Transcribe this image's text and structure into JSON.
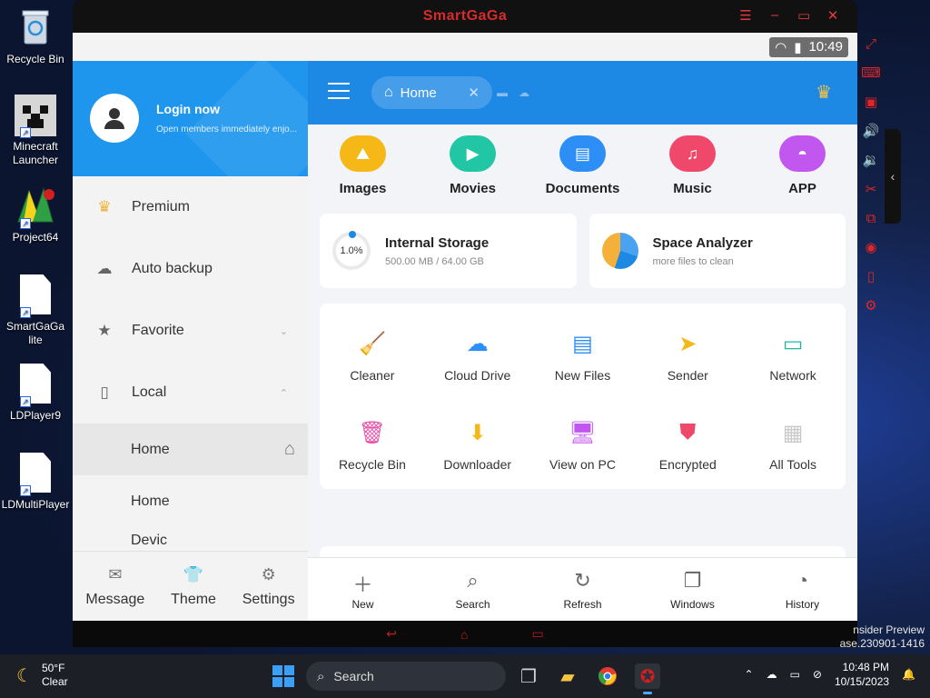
{
  "desktop": {
    "icons": [
      {
        "label": "Recycle Bin"
      },
      {
        "label": "Minecraft Launcher"
      },
      {
        "label": "Project64"
      },
      {
        "label": "SmartGaGa lite"
      },
      {
        "label": "LDPlayer9"
      },
      {
        "label": "LDMultiPlayer"
      }
    ]
  },
  "emulator": {
    "title": "SmartGaGa",
    "time": "10:49"
  },
  "drawer": {
    "login": "Login now",
    "login_sub": "Open members immediately enjo...",
    "items": [
      {
        "label": "Premium"
      },
      {
        "label": "Auto backup"
      },
      {
        "label": "Favorite"
      },
      {
        "label": "Local"
      }
    ],
    "sub_items": [
      {
        "label": "Home"
      },
      {
        "label": "Home"
      },
      {
        "label": "Devic"
      }
    ],
    "footer": [
      {
        "label": "Message"
      },
      {
        "label": "Theme"
      },
      {
        "label": "Settings"
      }
    ]
  },
  "main": {
    "tab_label": "Home",
    "categories": [
      {
        "label": "Images",
        "color": "#f5b816"
      },
      {
        "label": "Movies",
        "color": "#21c7a4"
      },
      {
        "label": "Documents",
        "color": "#2d8ef5"
      },
      {
        "label": "Music",
        "color": "#f0486a"
      },
      {
        "label": "APP",
        "color": "#c257ef"
      }
    ],
    "storage": {
      "title": "Internal Storage",
      "percent": "1.0%",
      "detail": "500.00 MB / 64.00 GB"
    },
    "analyzer": {
      "title": "Space Analyzer",
      "detail": "more files to clean"
    },
    "tools": [
      {
        "label": "Cleaner",
        "color": "#21b8a0"
      },
      {
        "label": "Cloud Drive",
        "color": "#2d8ef5"
      },
      {
        "label": "New Files",
        "color": "#2d8ef5"
      },
      {
        "label": "Sender",
        "color": "#f5b816"
      },
      {
        "label": "Network",
        "color": "#21b8a0"
      },
      {
        "label": "Recycle Bin",
        "color": "#e84ea8"
      },
      {
        "label": "Downloader",
        "color": "#f5b816"
      },
      {
        "label": "View on PC",
        "color": "#c257ef"
      },
      {
        "label": "Encrypted",
        "color": "#f0486a"
      },
      {
        "label": "All Tools",
        "color": "#c9c9c9"
      }
    ],
    "bottom": [
      {
        "label": "New"
      },
      {
        "label": "Search"
      },
      {
        "label": "Refresh"
      },
      {
        "label": "Windows"
      },
      {
        "label": "History"
      }
    ]
  },
  "watermark": {
    "line1": "nsider Preview",
    "line2": "ase.230901-1416"
  },
  "taskbar": {
    "temp": "50°F",
    "condition": "Clear",
    "search_label": "Search",
    "time": "10:48 PM",
    "date": "10/15/2023"
  }
}
